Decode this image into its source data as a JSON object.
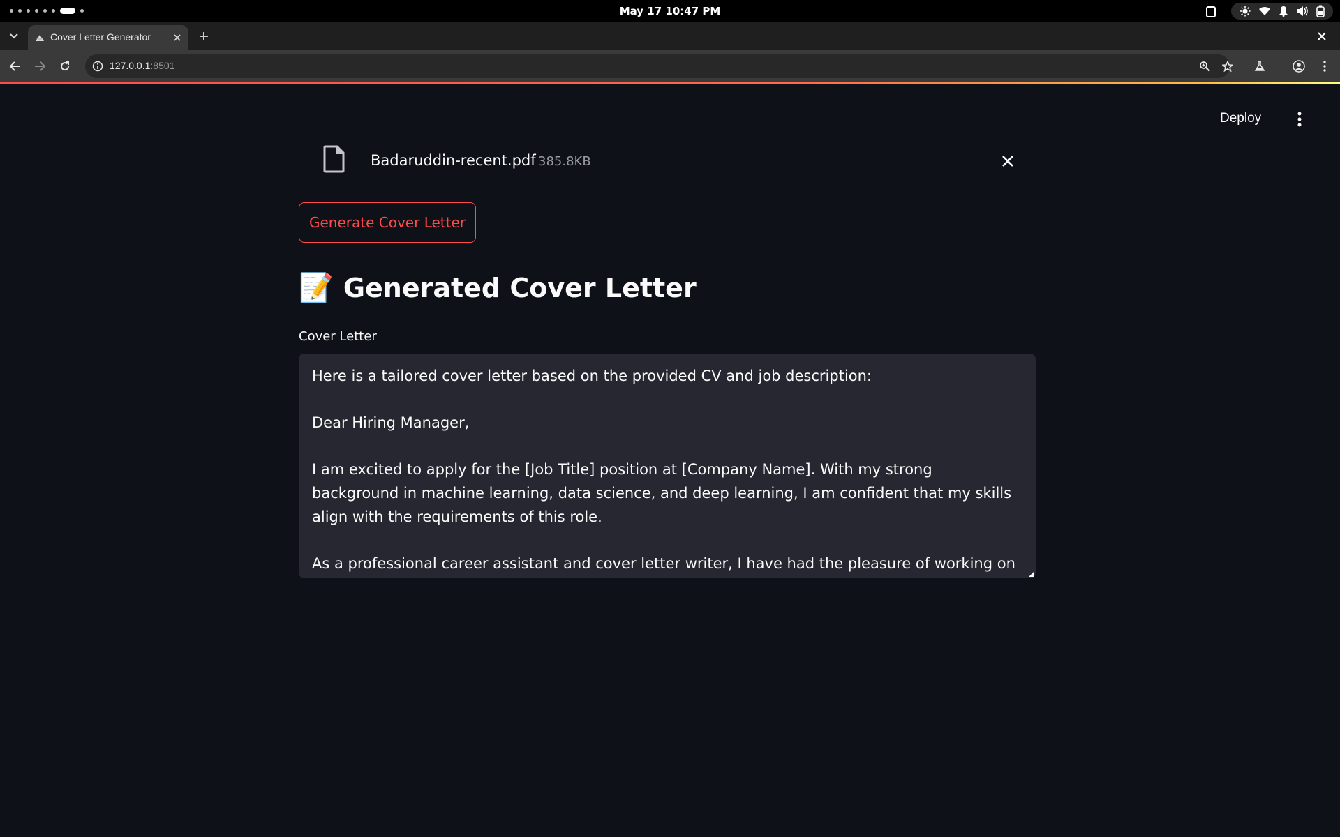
{
  "os_bar": {
    "datetime": "May 17  10:47 PM"
  },
  "browser": {
    "tab_title": "Cover Letter Generator",
    "url_host": "127.0.0.1",
    "url_port": ":8501"
  },
  "app": {
    "deploy_label": "Deploy",
    "file": {
      "name": "Badaruddin-recent.pdf",
      "size": "385.8KB"
    },
    "generate_button": "Generate Cover Letter",
    "heading_emoji": "📝",
    "heading": "Generated Cover Letter",
    "text_area_label": "Cover Letter",
    "cover_letter_text": "Here is a tailored cover letter based on the provided CV and job description:\n\nDear Hiring Manager,\n\nI am excited to apply for the [Job Title] position at [Company Name]. With my strong background in machine learning, data science, and deep learning, I am confident that my skills align with the requirements of this role.\n\nAs a professional career assistant and cover letter writer, I have had the pleasure of working on various projects that demonstrate my expertise. My experience in writing code in Python, Java, Matlab, and JavaScript has allowed me to develop a strong foundation in programming languages. Additionally, my proficiency in Deep Learning frameworks such as TensorFlow, Keras, PyTorch, and OpenCV has enabled me to work efficiently with complex data sets.\n\nMy passion for machine learning has led me to explore various applications, including handwritten digit recognition using Python, sentiment analysis on Twitter tweets, and fake news detection using SVM, Random Forest, and Decision Trees models. These projects have equipped me with the skills to analyze complex data sets, develop predictive models, and visualize results effectively."
  },
  "colors": {
    "accent": "#ff4b4b",
    "background": "#0e1117",
    "textarea_bg": "#262730"
  },
  "icons": [
    "workspace-dots-icon",
    "clipboard-icon",
    "brightness-icon",
    "wifi-icon",
    "notification-icon",
    "volume-icon",
    "battery-icon",
    "tab-list-icon",
    "streamlit-favicon",
    "close-icon",
    "plus-icon",
    "back-arrow-icon",
    "forward-arrow-icon",
    "reload-icon",
    "info-icon",
    "zoom-icon",
    "star-icon",
    "labs-icon",
    "profile-icon",
    "menu-dots-icon",
    "file-icon"
  ]
}
